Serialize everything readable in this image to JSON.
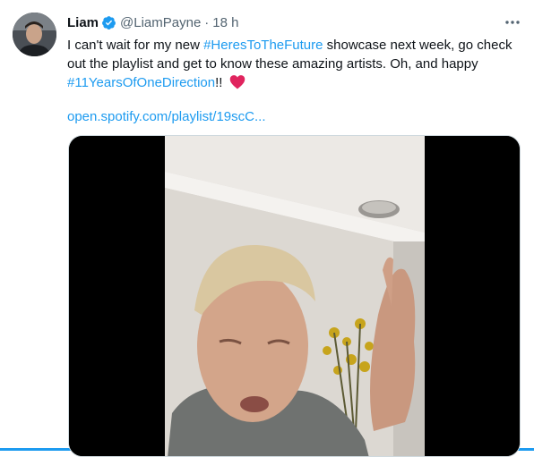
{
  "author": {
    "name": "Liam",
    "handle": "@LiamPayne",
    "separator": "·",
    "time": "18 h",
    "verified": true
  },
  "tweet": {
    "text_1": "I can't wait for my new ",
    "hashtag_1": "#HeresToTheFuture",
    "text_2": " showcase next week, go check out the playlist and get to know these amazing artists. Oh, and happy ",
    "hashtag_2": "#11YearsOfOneDirection",
    "text_3": "!! ",
    "emoji": "red-heart-icon",
    "link": "open.spotify.com/playlist/19scC..."
  },
  "media": {
    "type": "video"
  },
  "colors": {
    "accent": "#1d9bf0",
    "text": "#0f1419",
    "secondary": "#536471",
    "heart": "#e0245e"
  }
}
